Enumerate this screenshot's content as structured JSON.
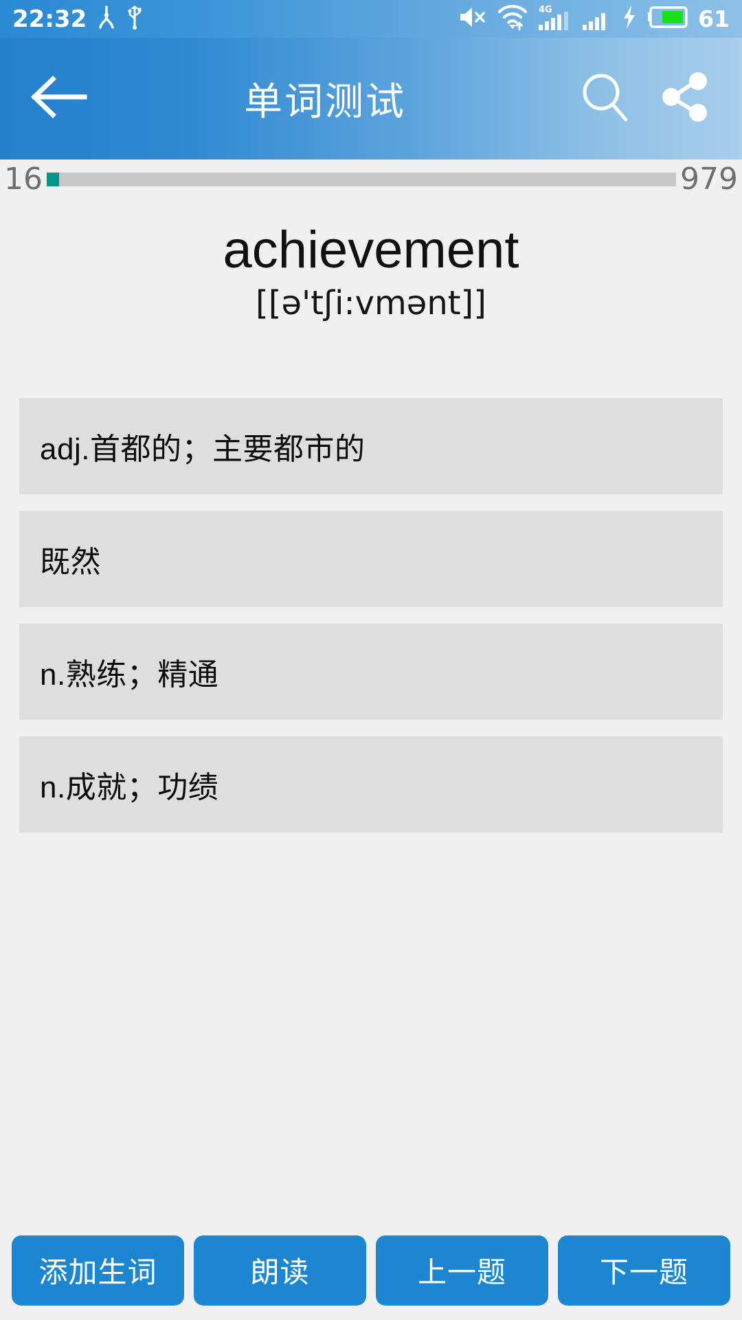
{
  "status_bar": {
    "time": "22:32",
    "battery_percent": "61",
    "icons": [
      "nfc-icon",
      "usb-icon",
      "mute-icon",
      "wifi-icon",
      "signal-4g-icon",
      "signal-icon",
      "charging-bolt-icon",
      "battery-icon"
    ],
    "network_label": "4G"
  },
  "app_bar": {
    "title": "单词测试",
    "back_icon": "back-arrow-icon",
    "search_icon": "search-icon",
    "share_icon": "share-icon"
  },
  "progress": {
    "current": "16",
    "total": "979",
    "fill_percent": 2.0,
    "fill_color": "#009688",
    "track_color": "#c8c8c8"
  },
  "word": {
    "spelling": "achievement",
    "phonetic": "[[ə'tʃi:vmənt]]"
  },
  "options": [
    {
      "label": "adj.首都的；主要都市的"
    },
    {
      "label": "既然"
    },
    {
      "label": "n.熟练；精通"
    },
    {
      "label": "n.成就；功绩"
    }
  ],
  "actions": [
    {
      "label": "添加生词",
      "name": "add-new-word-button"
    },
    {
      "label": "朗读",
      "name": "read-aloud-button"
    },
    {
      "label": "上一题",
      "name": "previous-question-button"
    },
    {
      "label": "下一题",
      "name": "next-question-button"
    }
  ],
  "colors": {
    "app_bar_start": "#2380cc",
    "app_bar_end": "#a9cfec",
    "button_blue": "#1c86d2",
    "option_card": "#dedede",
    "page_background": "#f0f0f0"
  }
}
